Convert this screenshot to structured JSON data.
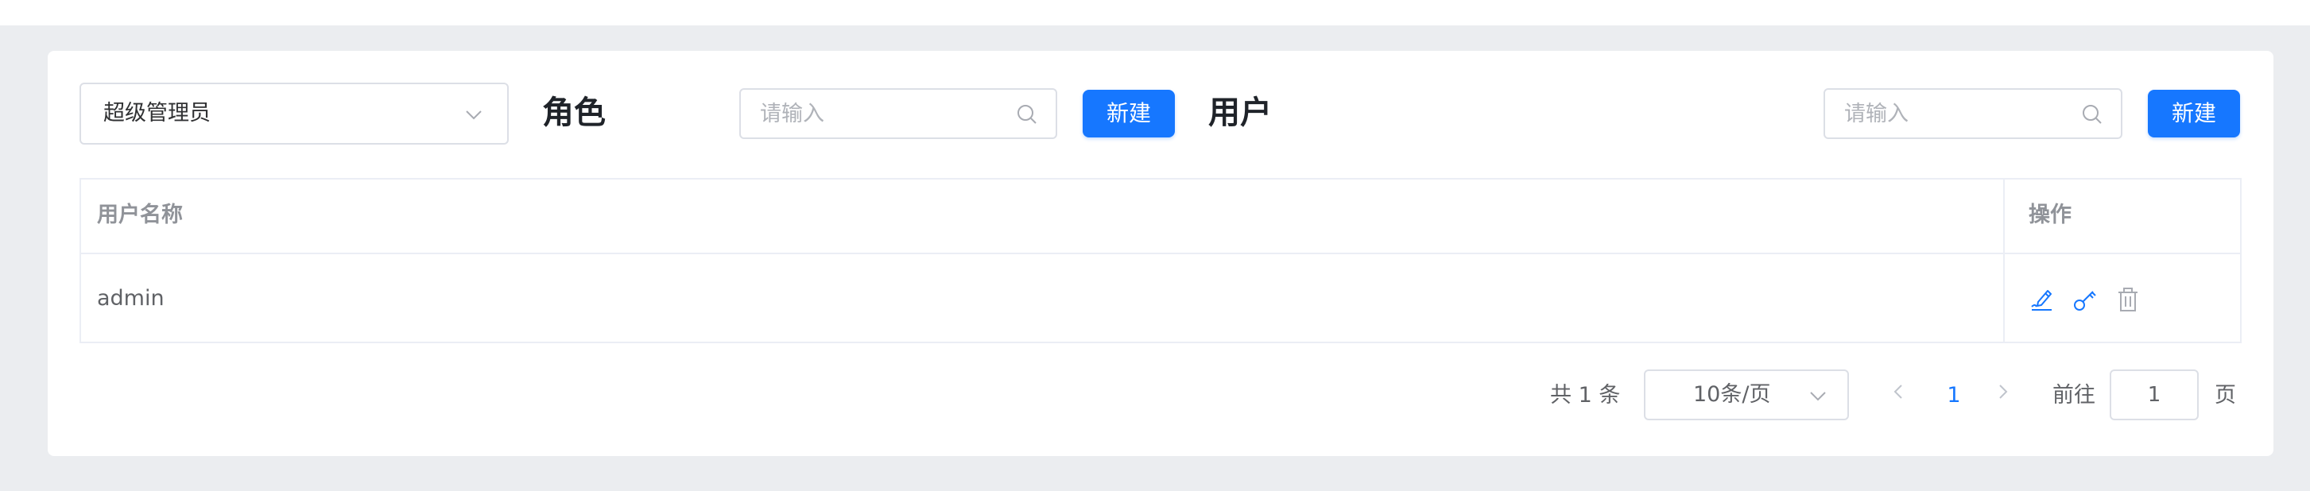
{
  "role_section": {
    "selected_role": "超级管理员",
    "title": "角色",
    "search_placeholder": "请输入",
    "new_button": "新建"
  },
  "user_section": {
    "title": "用户",
    "search_placeholder": "请输入",
    "new_button": "新建"
  },
  "table": {
    "columns": [
      "用户名称",
      "操作"
    ],
    "rows": [
      {
        "username": "admin",
        "actions": [
          "edit-icon",
          "key-icon",
          "delete-icon"
        ]
      }
    ]
  },
  "pagination": {
    "total_text": "共 1 条",
    "page_size": "10条/页",
    "current_page": "1",
    "goto_label": "前往",
    "goto_value": "1",
    "page_suffix": "页"
  },
  "colors": {
    "primary": "#1677ff",
    "background": "#ebedf0",
    "border": "#dcdfe6",
    "header_text": "#909399"
  }
}
